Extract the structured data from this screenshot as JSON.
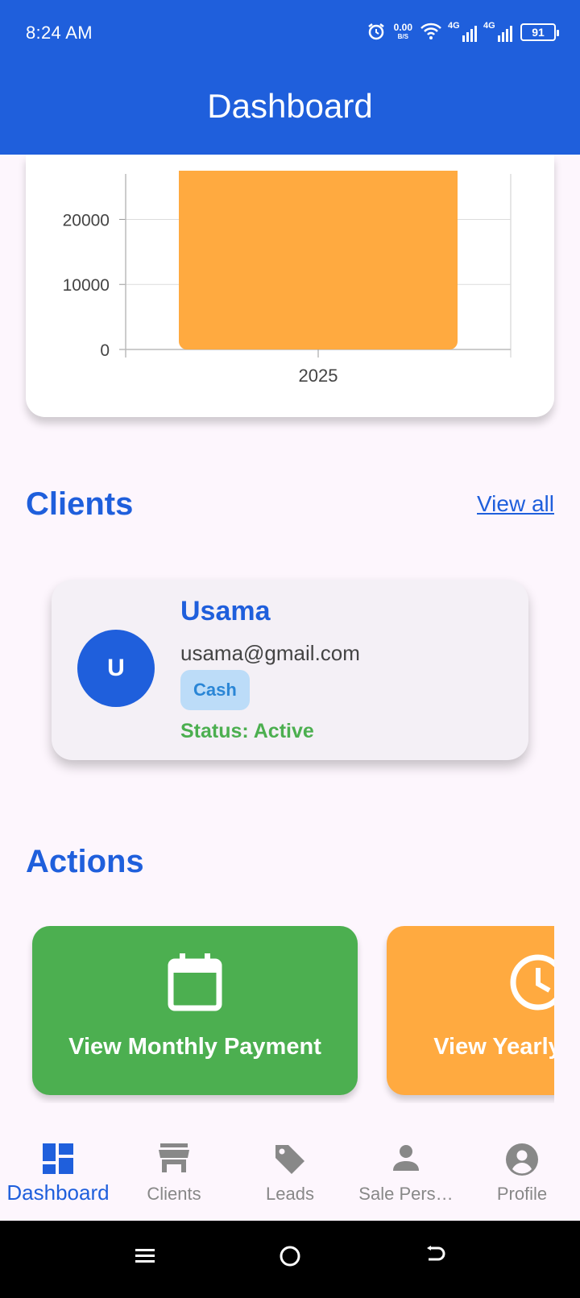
{
  "status_bar": {
    "time": "8:24 AM",
    "net_speed_value": "0.00",
    "net_speed_unit": "B/S",
    "sim1": "4G",
    "sim2": "4G",
    "battery": "91"
  },
  "app_bar": {
    "title": "Dashboard"
  },
  "chart_data": {
    "type": "bar",
    "categories": [
      "2025"
    ],
    "values": [
      26000
    ],
    "yticks": [
      "0",
      "10000",
      "20000"
    ],
    "ylim": [
      0,
      26000
    ],
    "bar_color": "#ffaa40"
  },
  "clients_section": {
    "title": "Clients",
    "view_all": "View all",
    "client": {
      "initial": "U",
      "name": "Usama",
      "email": "usama@gmail.com",
      "payment_type": "Cash",
      "status": "Status: Active"
    }
  },
  "actions_section": {
    "title": "Actions",
    "buttons": [
      {
        "label": "View Monthly Payment",
        "icon": "calendar-icon",
        "color": "#4caf50"
      },
      {
        "label": "View Yearly Payment",
        "icon": "clock-icon",
        "color": "#ffaa40"
      }
    ]
  },
  "bottom_nav": {
    "items": [
      {
        "label": "Dashboard",
        "icon": "dashboard-icon",
        "active": true
      },
      {
        "label": "Clients",
        "icon": "store-icon",
        "active": false
      },
      {
        "label": "Leads",
        "icon": "tag-icon",
        "active": false
      },
      {
        "label": "Sale Pers…",
        "icon": "person-icon",
        "active": false
      },
      {
        "label": "Profile",
        "icon": "account-circle-icon",
        "active": false
      }
    ]
  },
  "colors": {
    "primary": "#1f5fdc",
    "success": "#4caf50",
    "warning": "#ffaa40",
    "badge_bg": "#bcdcf8"
  }
}
